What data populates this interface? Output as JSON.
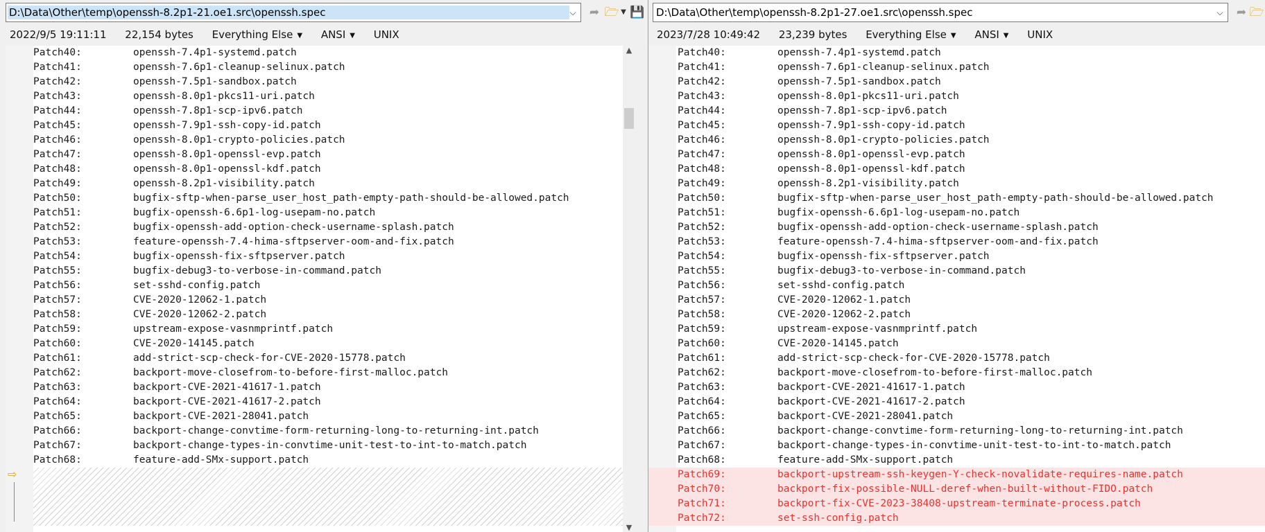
{
  "left": {
    "path": "D:\\Data\\Other\\temp\\openssh-8.2p1-21.oe1.src\\openssh.spec",
    "timestamp": "2022/9/5 19:11:11",
    "size": "22,154 bytes",
    "filter": "Everything Else",
    "encoding": "ANSI",
    "line_ending": "UNIX"
  },
  "right": {
    "path": "D:\\Data\\Other\\temp\\openssh-8.2p1-27.oe1.src\\openssh.spec",
    "timestamp": "2023/7/28 10:49:42",
    "size": "23,239 bytes",
    "filter": "Everything Else",
    "encoding": "ANSI",
    "line_ending": "UNIX"
  },
  "icons": {
    "dropdown": "chevron-down-icon",
    "next_diff": "next-difference-icon",
    "open_folder": "open-folder-icon",
    "save": "save-icon",
    "gutter_arrow": "diff-arrow-icon"
  },
  "colors": {
    "added_bg": "#fde4e4",
    "added_text": "#e8322f",
    "selection": "#cce4f7"
  },
  "common_lines": [
    [
      "Patch40:",
      "openssh-7.4p1-systemd.patch"
    ],
    [
      "Patch41:",
      "openssh-7.6p1-cleanup-selinux.patch"
    ],
    [
      "Patch42:",
      "openssh-7.5p1-sandbox.patch"
    ],
    [
      "Patch43:",
      "openssh-8.0p1-pkcs11-uri.patch"
    ],
    [
      "Patch44:",
      "openssh-7.8p1-scp-ipv6.patch"
    ],
    [
      "Patch45:",
      "openssh-7.9p1-ssh-copy-id.patch"
    ],
    [
      "Patch46:",
      "openssh-8.0p1-crypto-policies.patch"
    ],
    [
      "Patch47:",
      "openssh-8.0p1-openssl-evp.patch"
    ],
    [
      "Patch48:",
      "openssh-8.0p1-openssl-kdf.patch"
    ],
    [
      "Patch49:",
      "openssh-8.2p1-visibility.patch"
    ],
    [
      "Patch50:",
      "bugfix-sftp-when-parse_user_host_path-empty-path-should-be-allowed.patch"
    ],
    [
      "Patch51:",
      "bugfix-openssh-6.6p1-log-usepam-no.patch"
    ],
    [
      "Patch52:",
      "bugfix-openssh-add-option-check-username-splash.patch"
    ],
    [
      "Patch53:",
      "feature-openssh-7.4-hima-sftpserver-oom-and-fix.patch"
    ],
    [
      "Patch54:",
      "bugfix-openssh-fix-sftpserver.patch"
    ],
    [
      "Patch55:",
      "bugfix-debug3-to-verbose-in-command.patch"
    ],
    [
      "Patch56:",
      "set-sshd-config.patch"
    ],
    [
      "Patch57:",
      "CVE-2020-12062-1.patch"
    ],
    [
      "Patch58:",
      "CVE-2020-12062-2.patch"
    ],
    [
      "Patch59:",
      "upstream-expose-vasnmprintf.patch"
    ],
    [
      "Patch60:",
      "CVE-2020-14145.patch"
    ],
    [
      "Patch61:",
      "add-strict-scp-check-for-CVE-2020-15778.patch"
    ],
    [
      "Patch62:",
      "backport-move-closefrom-to-before-first-malloc.patch"
    ],
    [
      "Patch63:",
      "backport-CVE-2021-41617-1.patch"
    ],
    [
      "Patch64:",
      "backport-CVE-2021-41617-2.patch"
    ],
    [
      "Patch65:",
      "backport-CVE-2021-28041.patch"
    ],
    [
      "Patch66:",
      "backport-change-convtime-form-returning-long-to-returning-int.patch"
    ],
    [
      "Patch67:",
      "backport-change-types-in-convtime-unit-test-to-int-to-match.patch"
    ],
    [
      "Patch68:",
      "feature-add-SMx-support.patch"
    ]
  ],
  "added_lines": [
    [
      "Patch69:",
      "backport-upstream-ssh-keygen-Y-check-novalidate-requires-name.patch"
    ],
    [
      "Patch70:",
      "backport-fix-possible-NULL-deref-when-built-without-FIDO.patch"
    ],
    [
      "Patch71:",
      "backport-fix-CVE-2023-38408-upstream-terminate-process.patch"
    ],
    [
      "Patch72:",
      "set-ssh-config.patch"
    ]
  ]
}
